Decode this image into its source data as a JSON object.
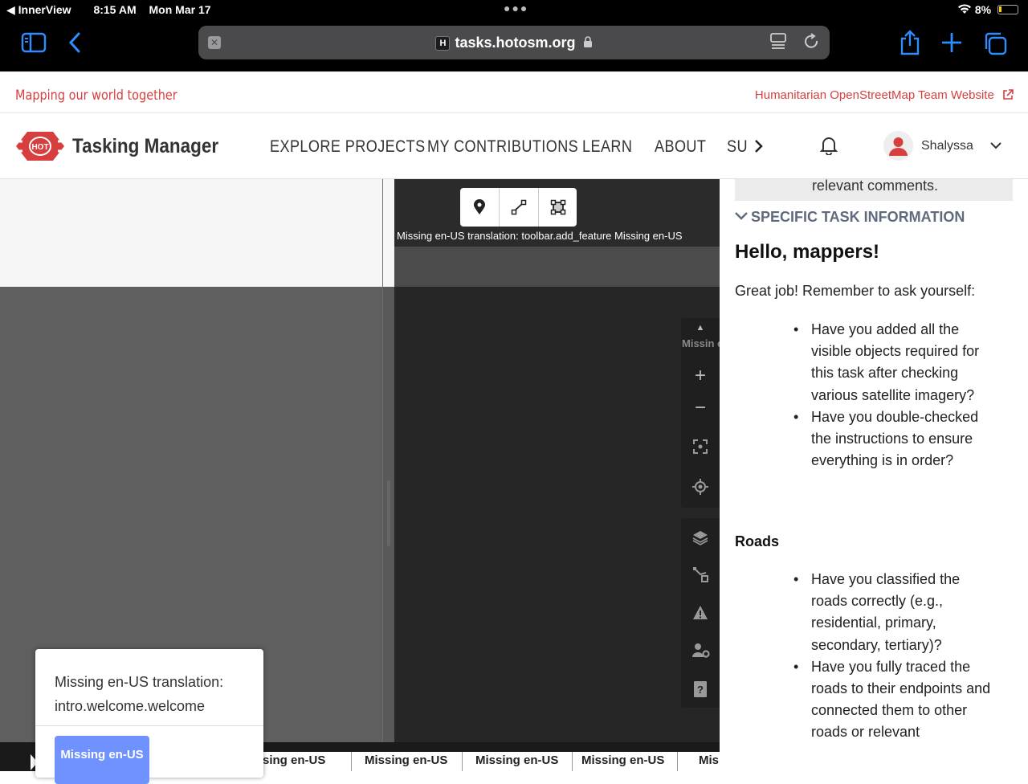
{
  "status_bar": {
    "app": "InnerView",
    "time": "8:15 AM",
    "date": "Mon Mar 17",
    "battery": "8%"
  },
  "browser": {
    "url": "tasks.hotosm.org",
    "favicon_letter": "H"
  },
  "site_header": {
    "tagline": "Mapping our world together",
    "external_link": "Humanitarian OpenStreetMap Team Website",
    "logo_text": "HOT",
    "brand": "Tasking Manager",
    "nav": [
      "EXPLORE PROJECTS",
      "MY CONTRIBUTIONS",
      "LEARN",
      "ABOUT",
      "SU"
    ],
    "user_name": "Shalyssa"
  },
  "editor": {
    "toolbar_label": "Missing en-US translation: toolbar.add_feature  Missing en-US",
    "zoom_label": "Missin en-US transla bearin",
    "welcome_message": "Missing en-US translation: intro.welcome.welcome",
    "welcome_button": "Missing en-US",
    "bottom_tabs": [
      "sing en-US",
      "Missing en-US",
      "Missing en-US",
      "Missing en-US",
      "Mis"
    ]
  },
  "instructions": {
    "prev_box_text": "relevant comments.",
    "section_title": "SPECIFIC TASK INFORMATION",
    "heading": "Hello, mappers!",
    "intro": "Great job! Remember to ask yourself:",
    "general_items": [
      "Have you added all the visible objects required for this task after checking various satellite imagery?",
      "Have you double-checked the instructions to ensure everything is in order?"
    ],
    "roads_heading": "Roads",
    "roads_items": [
      "Have you classified the roads correctly (e.g., residential, primary, secondary, tertiary)?",
      "Have you fully traced the roads to their endpoints and connected them to other roads or relevant"
    ]
  },
  "colors": {
    "hot_red": "#d73f3f",
    "ios_blue": "#2f8cff",
    "id_blue": "#7092ff"
  }
}
